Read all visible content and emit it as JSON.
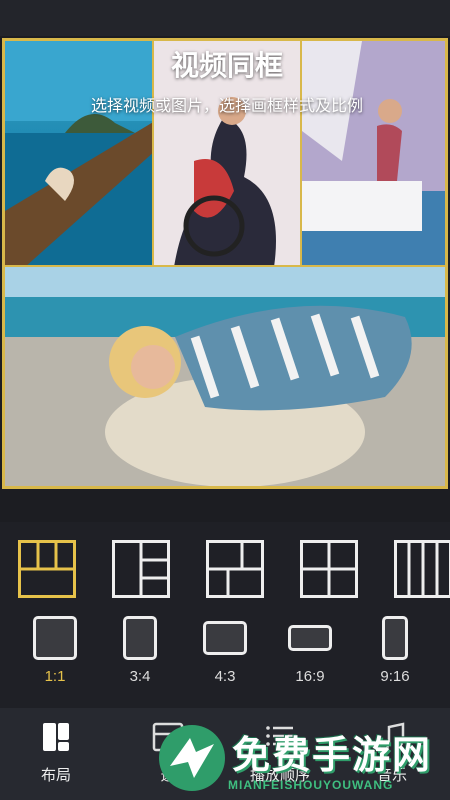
{
  "collage": {
    "title": "视频同框",
    "subtitle": "选择视频或图片，选择画框样式及比例"
  },
  "layouts": [
    {
      "name": "layout-3top-1bottom",
      "selected": true
    },
    {
      "name": "layout-left-big-right-split",
      "selected": false
    },
    {
      "name": "layout-2x2-split-mixed",
      "selected": false
    },
    {
      "name": "layout-2x2-grid",
      "selected": false
    },
    {
      "name": "layout-4-columns",
      "selected": false
    }
  ],
  "ratios": [
    {
      "label": "1:1",
      "selected": true
    },
    {
      "label": "3:4",
      "selected": false
    },
    {
      "label": "4:3",
      "selected": false
    },
    {
      "label": "16:9",
      "selected": false
    },
    {
      "label": "9:16",
      "selected": false
    }
  ],
  "nav": {
    "layout_label": "布局",
    "edit_label": "选",
    "order_label": "播放顺序",
    "music_label": "音乐"
  },
  "watermark": {
    "text": "免费手游网",
    "sub": "MIANFEISHOUYOUWANG"
  },
  "colors": {
    "accent": "#d8b84a",
    "panel": "#1f2026",
    "nav": "#272930"
  }
}
